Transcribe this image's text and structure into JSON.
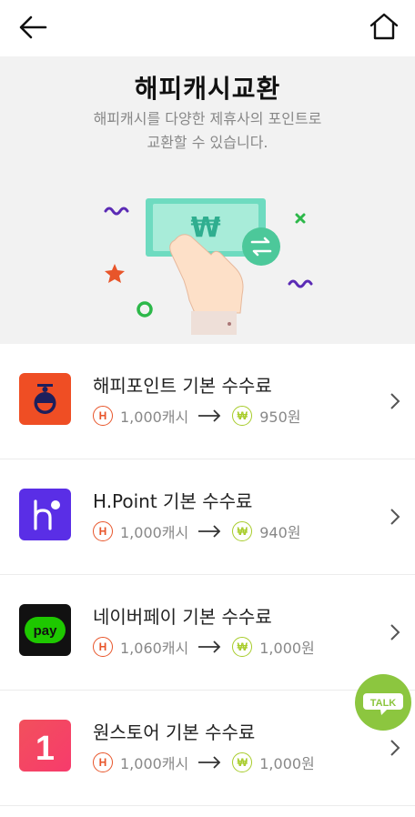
{
  "colors": {
    "accent_orange": "#e8552a",
    "accent_green": "#a7cc2a",
    "talk_green": "#8cc63f"
  },
  "header": {
    "back_icon": "arrow-left-icon",
    "home_icon": "home-icon"
  },
  "hero": {
    "title": "해피캐시교환",
    "desc_line1": "해피캐시를 다양한 제휴사의 포인트로",
    "desc_line2": "교환할 수 있습니다."
  },
  "partners": [
    {
      "name": "해피포인트 기본 수수료",
      "cash": "1,000캐시",
      "points": "950원",
      "logo": "happypoint-logo"
    },
    {
      "name": "H.Point 기본 수수료",
      "cash": "1,000캐시",
      "points": "940원",
      "logo": "hpoint-logo"
    },
    {
      "name": "네이버페이 기본 수수료",
      "cash": "1,060캐시",
      "points": "1,000원",
      "logo": "naverpay-logo",
      "logo_text": "pay"
    },
    {
      "name": "원스토어 기본 수수료",
      "cash": "1,000캐시",
      "points": "1,000원",
      "logo": "onestore-logo",
      "logo_text": "1"
    }
  ],
  "badges": {
    "happycash": "H",
    "won": "₩"
  },
  "talk_button": {
    "label": "TALK"
  }
}
